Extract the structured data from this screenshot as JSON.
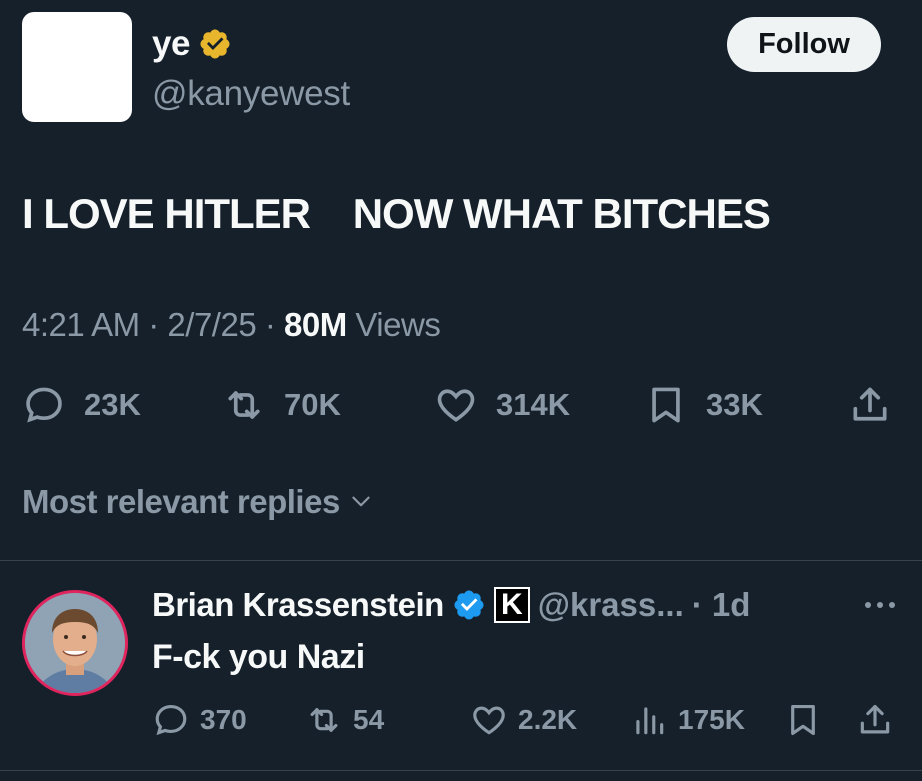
{
  "tweet": {
    "display_name": "ye",
    "handle": "@kanyewest",
    "follow_label": "Follow",
    "text": "I LOVE HITLER    NOW WHAT BITCHES",
    "time": "4:21 AM",
    "date": "2/7/25",
    "views_count": "80M",
    "views_label": "Views",
    "sep": "·",
    "stats": {
      "replies": "23K",
      "retweets": "70K",
      "likes": "314K",
      "bookmarks": "33K"
    }
  },
  "replies_section": {
    "sort_label": "Most relevant replies"
  },
  "reply": {
    "display_name": "Brian Krassenstein",
    "k_badge_letter": "K",
    "handle": "@krass...",
    "age": "· 1d",
    "text": "F-ck you Nazi",
    "stats": {
      "replies": "370",
      "retweets": "54",
      "likes": "2.2K",
      "views": "175K"
    }
  },
  "colors": {
    "background": "#15202b",
    "muted": "#8b98a5",
    "gold_badge": "#e8b62c",
    "blue_badge": "#1d9bf0",
    "follow_bg": "#eff3f4"
  },
  "icons": {
    "reply": "reply-icon",
    "retweet": "retweet-icon",
    "like": "heart-icon",
    "bookmark": "bookmark-icon",
    "share": "share-icon",
    "views": "views-chart-icon",
    "more": "more-dots-icon",
    "chevron": "chevron-down-icon"
  }
}
